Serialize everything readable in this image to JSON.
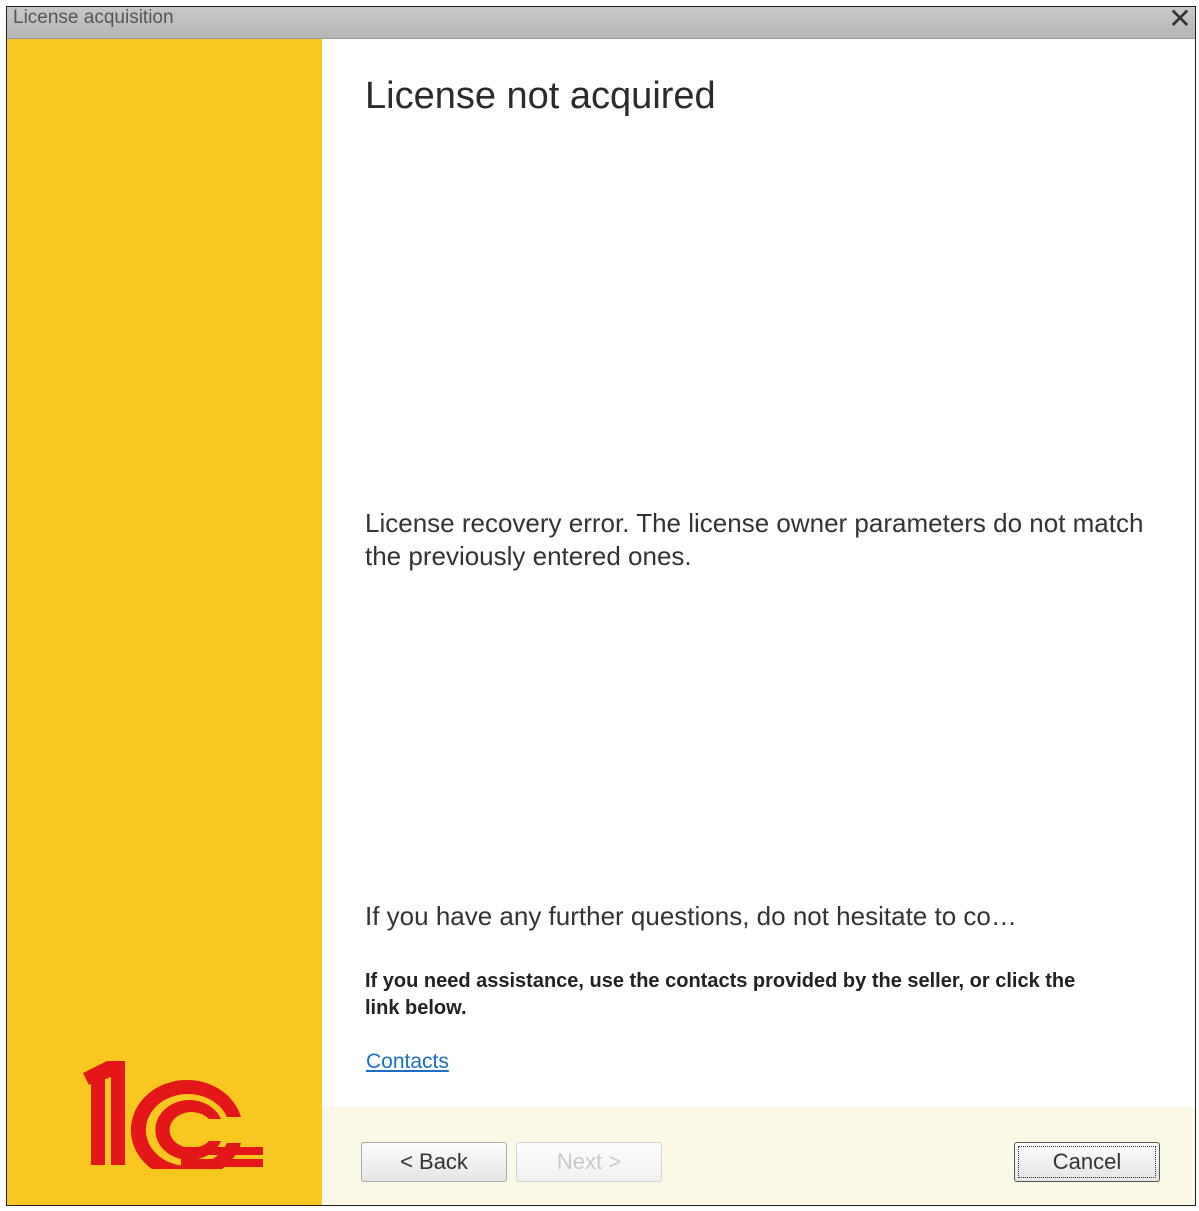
{
  "window": {
    "title": "License acquisition",
    "close_glyph": "✕"
  },
  "sidebar": {
    "logo": "1c-logo",
    "brand_color": "#f8c820",
    "logo_color": "#e3161a"
  },
  "content": {
    "heading": "License not acquired",
    "error_message": "License recovery error. The license owner parameters do not match the previously entered ones.",
    "questions_text": "If you have any further questions, do not hesitate to co…",
    "assistance_text": "If you need assistance, use the contacts provided by the seller, or click the link below.",
    "contacts_link": "Contacts",
    "link_color": "#1a6fc4"
  },
  "footer": {
    "back_label": "< Back",
    "next_label": "Next >",
    "next_enabled": false,
    "cancel_label": "Cancel"
  }
}
